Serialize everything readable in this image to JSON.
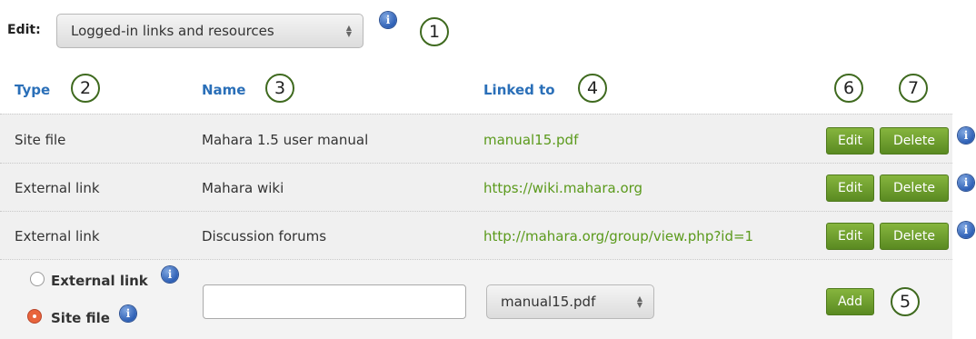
{
  "edit": {
    "label": "Edit:",
    "select_value": "Logged-in links and resources"
  },
  "columns": {
    "type": "Type",
    "name": "Name",
    "linked_to": "Linked to"
  },
  "rows": [
    {
      "type": "Site file",
      "name": "Mahara 1.5 user manual",
      "link": "manual15.pdf"
    },
    {
      "type": "External link",
      "name": "Mahara wiki",
      "link": "https://wiki.mahara.org"
    },
    {
      "type": "External link",
      "name": "Discussion forums",
      "link": "http://mahara.org/group/view.php?id=1"
    }
  ],
  "buttons": {
    "edit": "Edit",
    "delete": "Delete",
    "add": "Add"
  },
  "add_row": {
    "radio_external": "External link",
    "radio_site_file": "Site file",
    "selected": "Site file",
    "name_value": "",
    "file_select_value": "manual15.pdf"
  },
  "callouts": [
    "1",
    "2",
    "3",
    "4",
    "5",
    "6",
    "7"
  ],
  "icons": {
    "info": "info-icon",
    "radio_selected": "radio-selected-icon"
  },
  "colors": {
    "header": "#2a6fb8",
    "link": "#5b9a1c",
    "button": "#6a9a2e",
    "callout_border": "#3f6a1f"
  }
}
